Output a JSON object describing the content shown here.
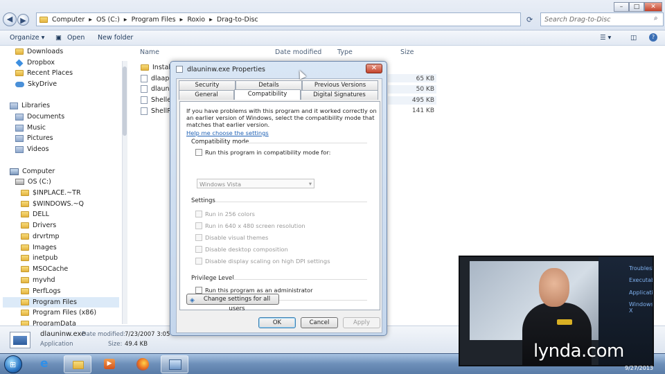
{
  "addressbar": {
    "crumbs": [
      "Computer",
      "OS (C:)",
      "Program Files",
      "Roxio",
      "Drag-to-Disc"
    ],
    "search_placeholder": "Search Drag-to-Disc"
  },
  "toolbar": {
    "organize": "Organize ▾",
    "open": "Open",
    "new_folder": "New folder"
  },
  "columns": {
    "name": "Name",
    "date_modified": "Date modified",
    "type": "Type",
    "size": "Size"
  },
  "navpane": {
    "items": [
      "Downloads",
      "Dropbox",
      "Recent Places",
      "SkyDrive",
      "Libraries",
      "Documents",
      "Music",
      "Pictures",
      "Videos",
      "Computer",
      "OS (C:)",
      "$INPLACE.~TR",
      "$WINDOWS.~Q",
      "DELL",
      "Drivers",
      "drvrtmp",
      "Images",
      "inetpub",
      "MSOCache",
      "myvhd",
      "PerfLogs",
      "Program Files",
      "Program Files (x86)",
      "ProgramData"
    ]
  },
  "files": {
    "names": [
      "Install",
      "dlaapi_",
      "dlaunir",
      "Shellex",
      "ShellRe"
    ],
    "sizes": [
      "65 KB",
      "50 KB",
      "495 KB",
      "141 KB"
    ]
  },
  "details": {
    "filename": "dlauninw.exe",
    "date_label": "Date modified:",
    "date_value": "7/23/2007 3:05 P",
    "type_value": "Application",
    "size_label": "Size:",
    "size_value": "49.4 KB"
  },
  "dialog": {
    "title": "dlauninw.exe Properties",
    "tabs": {
      "security": "Security",
      "details": "Details",
      "previous_versions": "Previous Versions",
      "general": "General",
      "compatibility": "Compatibility",
      "digital_signatures": "Digital Signatures"
    },
    "intro_lines": [
      "If you have problems with this program and it worked correctly on",
      "an earlier version of Windows, select the compatibility mode that",
      "matches that earlier version."
    ],
    "help_link": "Help me choose the settings",
    "compat_group": "Compatibility mode",
    "compat_checkbox": "Run this program in compatibility mode for:",
    "compat_select": "Windows Vista",
    "settings_group": "Settings",
    "settings": [
      "Run in 256 colors",
      "Run in 640 x 480 screen resolution",
      "Disable visual themes",
      "Disable desktop composition",
      "Disable display scaling on high DPI settings"
    ],
    "privilege_group": "Privilege Level",
    "admin_checkbox": "Run this program as an administrator",
    "change_all": "Change settings for all users",
    "ok": "OK",
    "cancel": "Cancel",
    "apply": "Apply"
  },
  "video": {
    "menu": [
      "Troublesho",
      "Executable",
      "Application",
      "Windows X"
    ],
    "brand": "lynda.com",
    "date": "9/27/2013"
  }
}
